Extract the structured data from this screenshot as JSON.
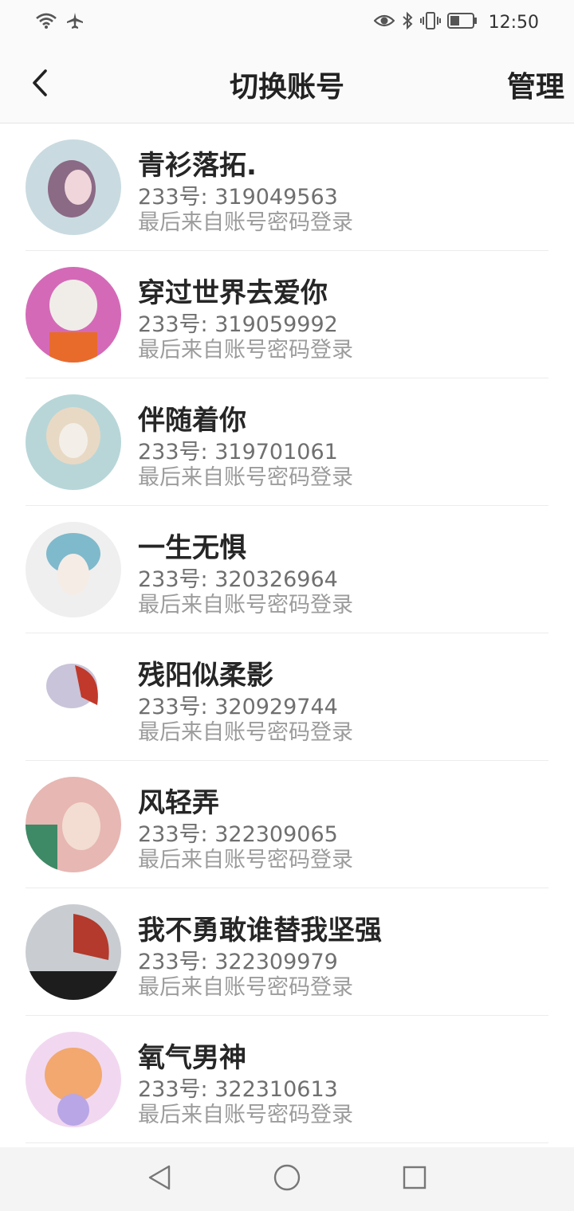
{
  "status_bar": {
    "time": "12:50",
    "icons_left": [
      "wifi-icon",
      "airplane-icon"
    ],
    "icons_right": [
      "eye-icon",
      "bluetooth-icon",
      "vibrate-icon",
      "battery-icon"
    ]
  },
  "header": {
    "title": "切换账号",
    "manage_label": "管理",
    "back_icon": "chevron-left-icon"
  },
  "accounts": [
    {
      "nickname": "青衫落拓.",
      "uid": "233号: 319049563",
      "login": "最后来自账号密码登录",
      "avatar_colors": [
        "#c9dbe0",
        "#8b6a86",
        "#f0d6da"
      ]
    },
    {
      "nickname": "穿过世界去爱你",
      "uid": "233号: 319059992",
      "login": "最后来自账号密码登录",
      "avatar_colors": [
        "#d46ab7",
        "#f0ede8",
        "#e86b2c"
      ]
    },
    {
      "nickname": "伴随着你",
      "uid": "233号: 319701061",
      "login": "最后来自账号密码登录",
      "avatar_colors": [
        "#b8d6d8",
        "#e8d9c5",
        "#f3efe8"
      ]
    },
    {
      "nickname": "一生无惧",
      "uid": "233号: 320326964",
      "login": "最后来自账号密码登录",
      "avatar_colors": [
        "#efefef",
        "#7fb9cc",
        "#f5ece6"
      ]
    },
    {
      "nickname": "残阳似柔影",
      "uid": "233号: 320929744",
      "login": "最后来自账号密码登录",
      "avatar_colors": [
        "#ffffff",
        "#c9c4d9",
        "#c0392b"
      ]
    },
    {
      "nickname": "风轻弄",
      "uid": "233号: 322309065",
      "login": "最后来自账号密码登录",
      "avatar_colors": [
        "#e7b7b3",
        "#3e8a66",
        "#f3ddd2"
      ]
    },
    {
      "nickname": "我不勇敢谁替我坚强",
      "uid": "233号: 322309979",
      "login": "最后来自账号密码登录",
      "avatar_colors": [
        "#c9cdd2",
        "#b33a2c",
        "#1d1d1d"
      ]
    },
    {
      "nickname": "氧气男神",
      "uid": "233号: 322310613",
      "login": "最后来自账号密码登录",
      "avatar_colors": [
        "#f1d8f0",
        "#f2a86f",
        "#b9a6e6"
      ]
    }
  ],
  "nav_bar": {
    "back": "triangle-back-icon",
    "home": "circle-home-icon",
    "recents": "square-recents-icon"
  }
}
